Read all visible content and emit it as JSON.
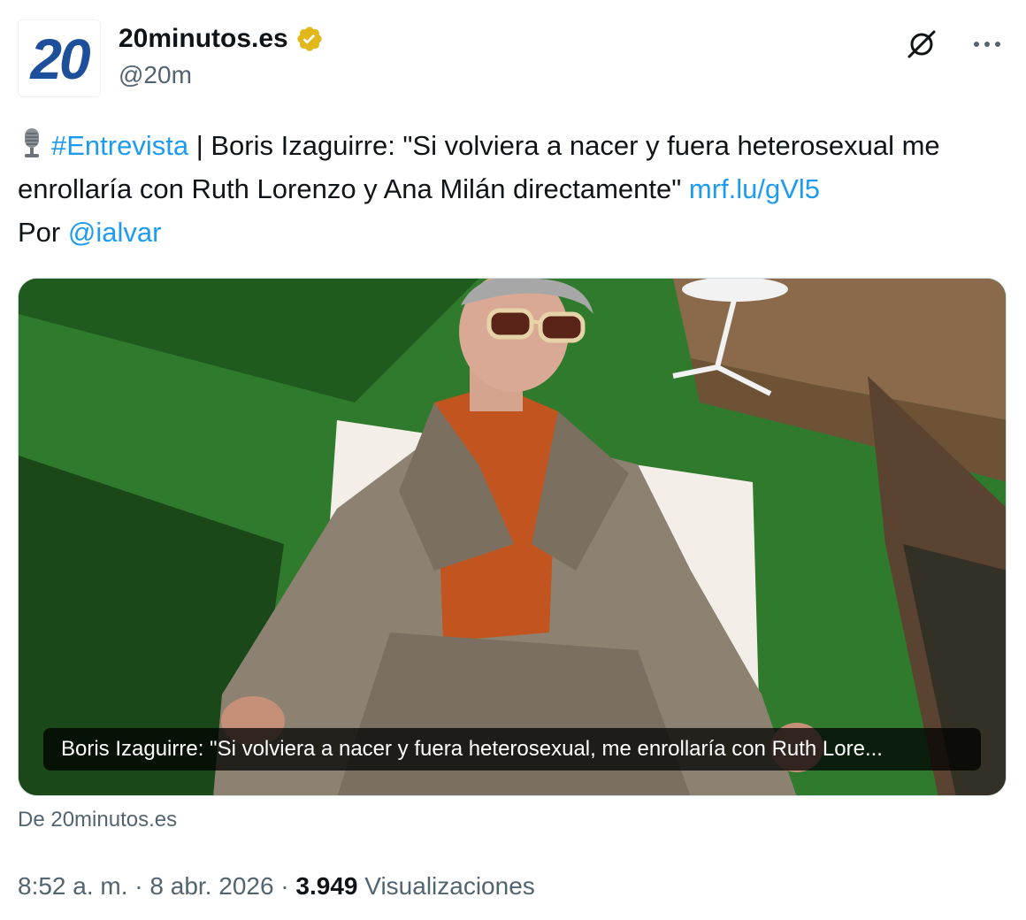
{
  "account": {
    "avatar_text": "20",
    "display_name": "20minutos.es",
    "handle": "@20m",
    "verified_icon": "verified-gold-badge-icon"
  },
  "actions": {
    "grok_icon": "grok-icon",
    "more_icon": "more-dots-icon"
  },
  "tweet": {
    "emoji": "studio-microphone-icon",
    "hashtag": "#Entrevista",
    "body_part1": " | Boris Izaguirre: \"Si volviera a nacer y fuera heterosexual me enrollaría con Ruth Lorenzo y Ana Milán directamente\" ",
    "link": "mrf.lu/gVl5",
    "by_prefix": "Por ",
    "mention": "@ialvar"
  },
  "card": {
    "caption": "Boris Izaguirre: \"Si volviera a nacer y fuera heterosexual, me enrollaría con Ruth Lore...",
    "source": "De 20minutos.es"
  },
  "meta": {
    "time": "8:52 a. m.",
    "sep": " · ",
    "date": "8 abr. 2026",
    "views_count": "3.949",
    "views_label": "Visualizaciones"
  },
  "colors": {
    "link": "#1d9bf0",
    "brand": "#1d4f9a",
    "secondary_text": "#536471"
  }
}
